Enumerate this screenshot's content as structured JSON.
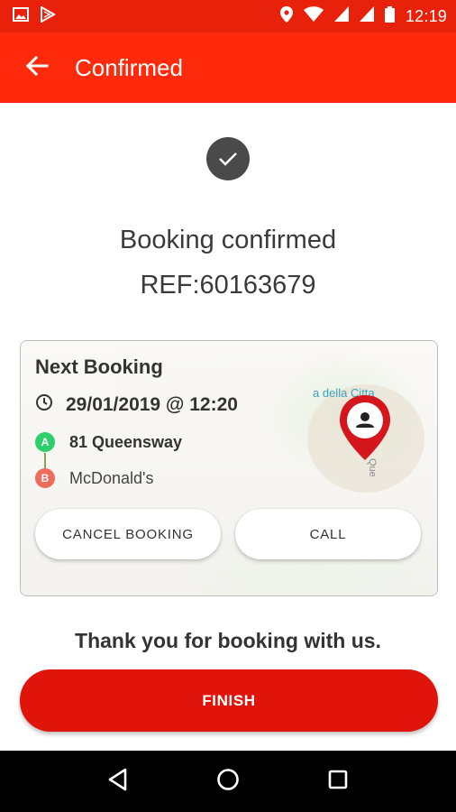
{
  "status_bar": {
    "time": "12:19",
    "left_icons": [
      "gallery-icon",
      "play-store-icon"
    ],
    "right_icons": [
      "location-icon",
      "wifi-icon",
      "signal-icon",
      "signal-icon",
      "battery-icon"
    ]
  },
  "app_bar": {
    "title": "Confirmed",
    "back_icon": "arrow-left-icon",
    "background": "#ff2a0b"
  },
  "confirmation": {
    "icon": "check-icon",
    "title": "Booking confirmed",
    "reference": "REF:60163679"
  },
  "booking_card": {
    "title": "Next Booking",
    "datetime": "29/01/2019 @ 12:20",
    "pickup": {
      "badge": "A",
      "address": "81 Queensway"
    },
    "dropoff": {
      "badge": "B",
      "address": "McDonald's"
    },
    "map_labels": {
      "street_top": "a della Citta",
      "street_side": "Que"
    },
    "cancel_label": "CANCEL BOOKING",
    "call_label": "CALL"
  },
  "thank_you": "Thank you for booking with us.",
  "finish_label": "FINISH",
  "colors": {
    "accent": "#e0140a",
    "pickup_badge": "#2ecf6a",
    "dropoff_badge": "#ef6b5b"
  },
  "nav_bar": {
    "buttons": [
      "back-triangle-icon",
      "home-circle-icon",
      "recents-square-icon"
    ]
  }
}
